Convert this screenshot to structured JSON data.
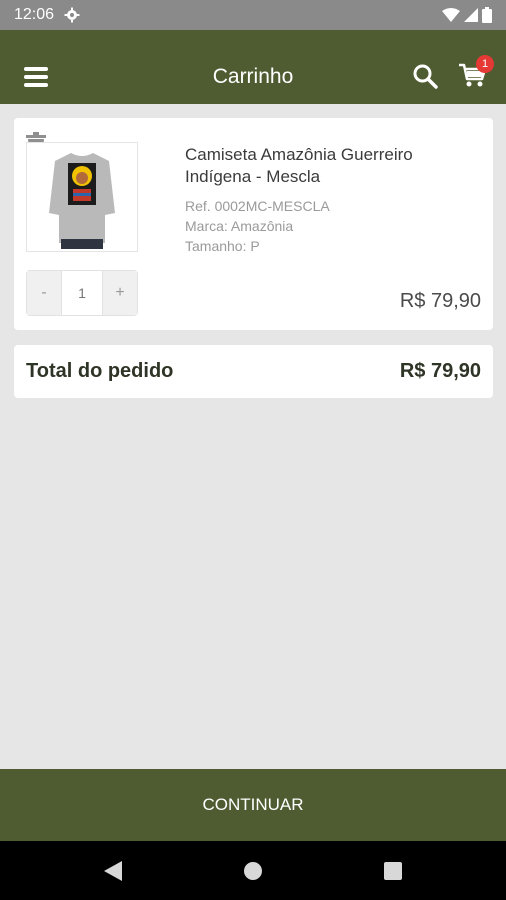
{
  "status_bar": {
    "time": "12:06"
  },
  "app_bar": {
    "title": "Carrinho",
    "cart_count": "1"
  },
  "cart": {
    "items": [
      {
        "name": "Camiseta Amazônia Guerreiro Indígena - Mescla",
        "ref": "Ref. 0002MC-MESCLA",
        "brand": "Marca: Amazônia",
        "size": "Tamanho: P",
        "quantity": "1",
        "minus_label": "-",
        "plus_label": "+",
        "price": "R$ 79,90"
      }
    ],
    "total_label": "Total do pedido",
    "total_value": "R$ 79,90"
  },
  "footer": {
    "continue_label": "CONTINUAR"
  },
  "colors": {
    "primary": "#4f5c31",
    "status_bar": "#8a8a8a",
    "badge": "#e53935",
    "background": "#e6e6e6"
  }
}
